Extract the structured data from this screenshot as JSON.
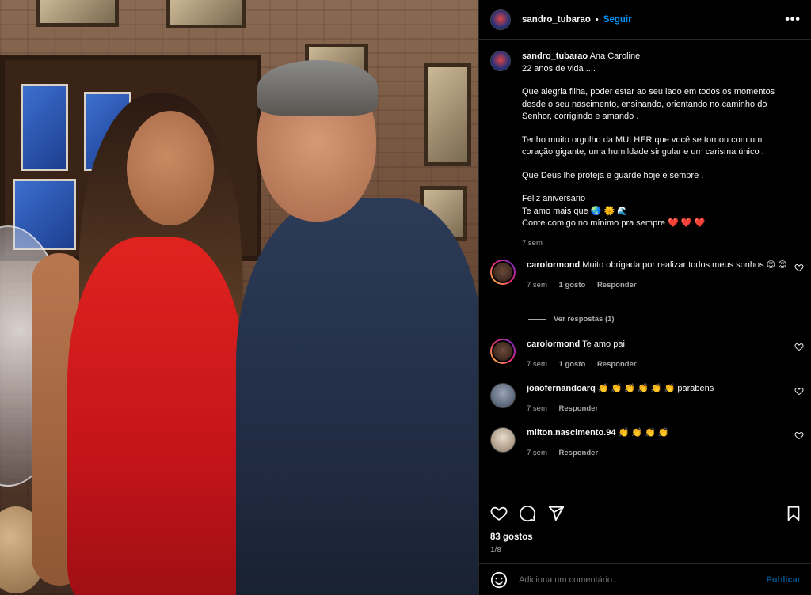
{
  "post": {
    "username": "sandro_tubarao",
    "follow_label": "Seguir",
    "separator": "•",
    "more_label": "•••"
  },
  "caption": {
    "username": "sandro_tubarao",
    "first_line": "Ana Caroline",
    "line2": "22 anos de vida ....",
    "para1": "Que alegria filha, poder estar ao seu lado em todos os momentos desde o seu nascimento, ensinando, orientando no caminho do Senhor, corrigindo e amando .",
    "para2": "Tenho muito orgulho da MULHER que você se tornou com um coração gigante, uma humildade singular e um carisma único .",
    "para3": "Que Deus lhe proteja e guarde hoje e sempre .",
    "para4_line1": "Feliz aniversário",
    "para4_line2": "Te amo mais que 🌏 🌞 🌊",
    "para4_line3": "Conte comigo no mínimo pra sempre ❤️ ❤️ ❤️",
    "time": "7 sem"
  },
  "comments": [
    {
      "username": "carolormond",
      "text": "Muito obrigada por realizar todos meus sonhos 😍 😍",
      "time": "7 sem",
      "likes": "1 gosto",
      "reply": "Responder"
    },
    {
      "username": "carolormond",
      "text": "Te amo pai",
      "time": "7 sem",
      "likes": "1 gosto",
      "reply": "Responder"
    },
    {
      "username": "joaofernandoarq",
      "text": "👏 👏 👏 👏 👏 👏 parabéns",
      "time": "7 sem",
      "reply": "Responder"
    },
    {
      "username": "milton.nascimento.94",
      "text": "👏 👏 👏 👏",
      "time": "7 sem",
      "reply": "Responder"
    }
  ],
  "view_replies": "Ver respostas (1)",
  "footer": {
    "likes": "83 gostos",
    "slide": "1/8",
    "comment_placeholder": "Adiciona um comentário...",
    "publish": "Publicar"
  },
  "colors": {
    "accent": "#0095f6",
    "background": "#000000",
    "muted": "#a8a8a8",
    "divider": "#262626"
  }
}
